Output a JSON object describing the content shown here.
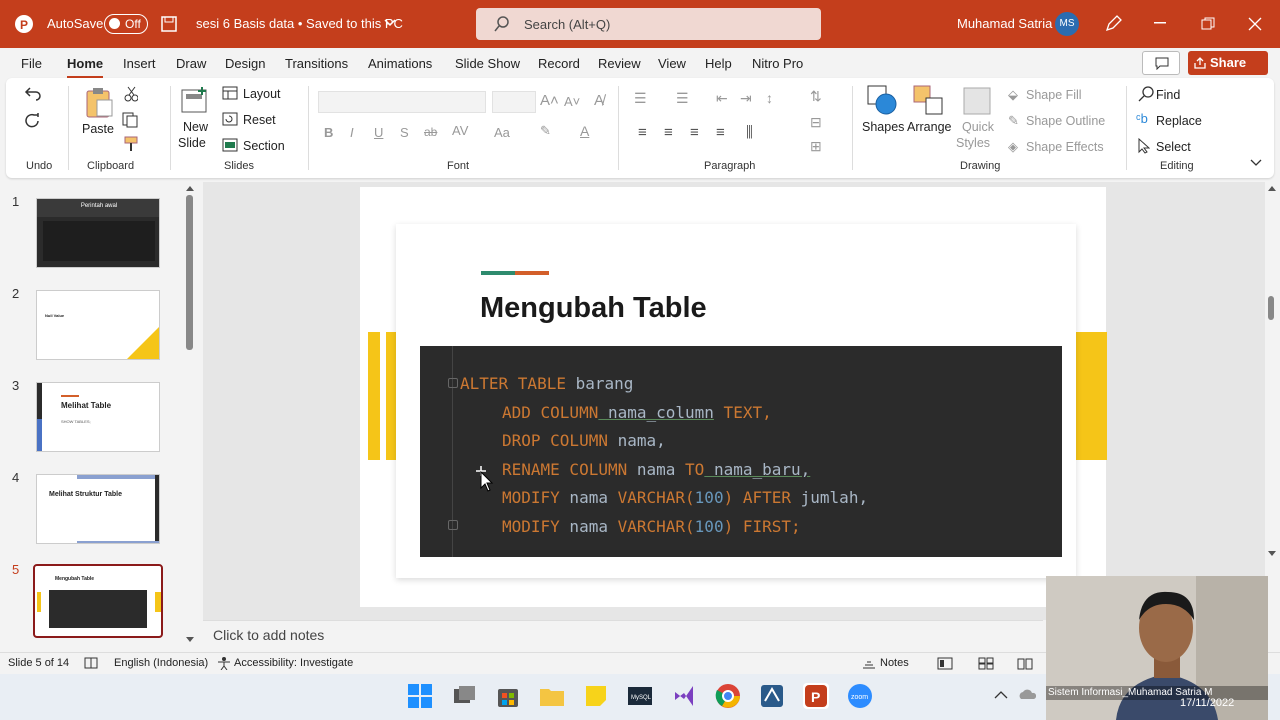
{
  "titlebar": {
    "autosave": "AutoSave",
    "autosave_state": "Off",
    "doc_title": "sesi 6 Basis data • Saved to this PC",
    "search_placeholder": "Search (Alt+Q)",
    "user": "Muhamad Satria",
    "initials": "MS"
  },
  "tabs": [
    "File",
    "Home",
    "Insert",
    "Draw",
    "Design",
    "Transitions",
    "Animations",
    "Slide Show",
    "Record",
    "Review",
    "View",
    "Help",
    "Nitro Pro"
  ],
  "share_label": "Share",
  "ribbon": {
    "undo": "Undo",
    "clipboard": "Clipboard",
    "paste": "Paste",
    "slides": "Slides",
    "new": "New",
    "slide": "Slide",
    "layout": "Layout",
    "reset": "Reset",
    "section": "Section",
    "font": "Font",
    "paragraph": "Paragraph",
    "drawing": "Drawing",
    "shapes": "Shapes",
    "arrange": "Arrange",
    "quick": "Quick",
    "styles": "Styles",
    "shape_fill": "Shape Fill",
    "shape_outline": "Shape Outline",
    "shape_effects": "Shape Effects",
    "editing": "Editing",
    "find": "Find",
    "replace": "Replace",
    "select": "Select"
  },
  "thumbnails": [
    {
      "num": "1",
      "title": "Perintah awal"
    },
    {
      "num": "2",
      "title": "Null Value"
    },
    {
      "num": "3",
      "title": "Melihat Table",
      "sub": "SHOW TABLES;"
    },
    {
      "num": "4",
      "title": "Melihat Struktur Table"
    },
    {
      "num": "5",
      "title": "Mengubah Table"
    }
  ],
  "slide": {
    "title": "Mengubah Table",
    "code": [
      {
        "kw": "ALTER TABLE",
        "rest": " barang"
      },
      {
        "kw": "ADD COLUMN",
        "rest": " nama_column",
        "kw2": " TEXT,"
      },
      {
        "kw": "DROP COLUMN",
        "rest": " nama,"
      },
      {
        "kw": "RENAME COLUMN",
        "rest": " nama",
        "kw2": " TO",
        "rest2": " nama_baru,"
      },
      {
        "kw": "MODIFY",
        "rest": " nama",
        "kw2": " VARCHAR(",
        "n": "100",
        "kw3": ") AFTER",
        "rest2": " jumlah,"
      },
      {
        "kw": "MODIFY",
        "rest": " nama",
        "kw2": " VARCHAR(",
        "n": "100",
        "kw3": ") FIRST;"
      }
    ]
  },
  "notes_placeholder": "Click to add notes",
  "status": {
    "slide": "Slide 5 of 14",
    "lang": "English (Indonesia)",
    "access": "Accessibility: Investigate",
    "notes": "Notes"
  },
  "webcam_caption": "Sistem Informasi_Muhamad Satria M",
  "clock_date": "17/11/2022",
  "colors": {
    "accent": "#c43e1c",
    "code_bg": "#2b2b2b",
    "yellow": "#f5c518",
    "teal": "#2e8b6e",
    "orange": "#d35f2a"
  }
}
